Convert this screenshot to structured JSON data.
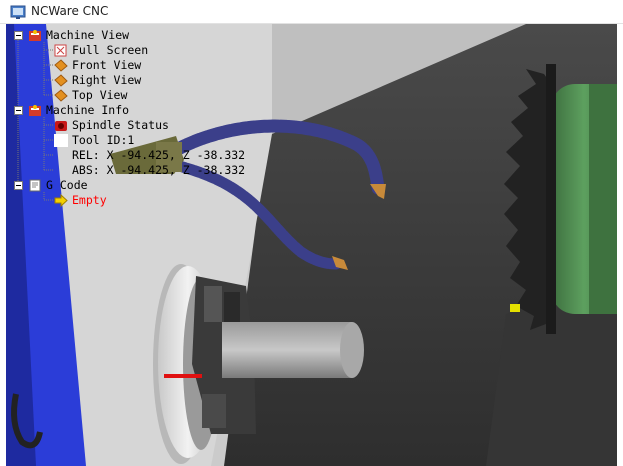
{
  "window": {
    "title": "NCWare CNC"
  },
  "tree": {
    "machine_view": {
      "label": "Machine View",
      "children": [
        "Full Screen",
        "Front View",
        "Right View",
        "Top View"
      ]
    },
    "machine_info": {
      "label": "Machine Info",
      "spindle_status": "Spindle Status",
      "tool_id": "Tool ID:1",
      "rel": "REL: X -94.425, Z -38.332",
      "abs": "ABS: X -94.425, Z -38.332"
    },
    "g_code": {
      "label": "G Code",
      "program": "Empty"
    }
  },
  "colors": {
    "blue_bar": "#2b3dd8",
    "gripper_green": "#4a8a4c",
    "hose_blue": "#3b3f8a",
    "nozzle": "#c88a3a",
    "chuck_mark": "#e01010",
    "empty_text": "#ff0000"
  }
}
